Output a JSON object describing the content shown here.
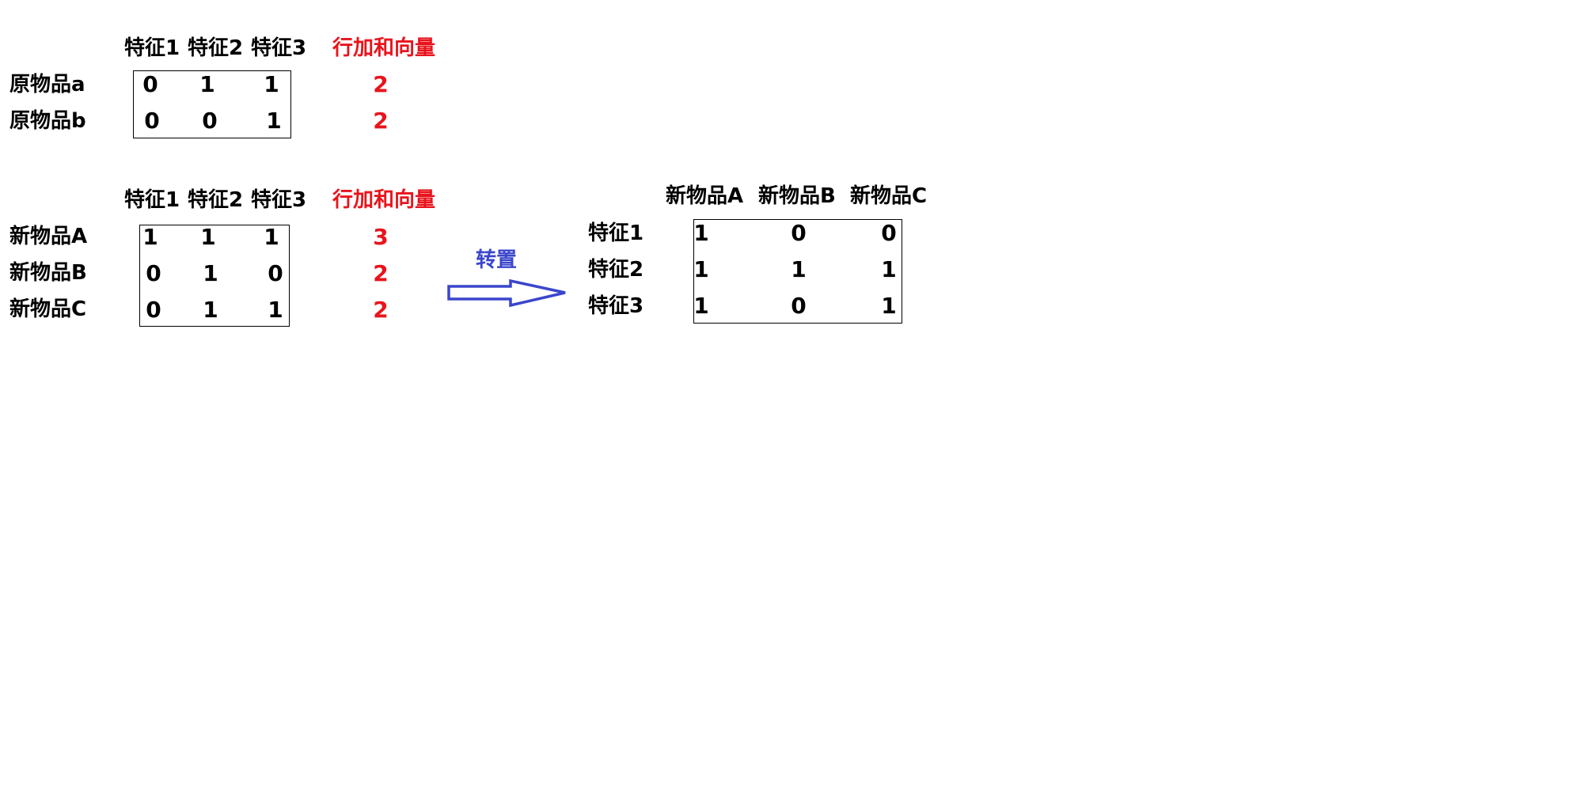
{
  "colors": {
    "text": "#000000",
    "highlight": "#e8141c",
    "arrow": "#3a46cc",
    "background": "#ffffff"
  },
  "original": {
    "headers": [
      "特征1",
      "特征2",
      "特征3"
    ],
    "sum_header": "行加和向量",
    "rows": [
      {
        "label": "原物品a",
        "values": [
          "0",
          "1",
          "1"
        ],
        "sum": "2"
      },
      {
        "label": "原物品b",
        "values": [
          "0",
          "0",
          "1"
        ],
        "sum": "2"
      }
    ]
  },
  "new": {
    "headers": [
      "特征1",
      "特征2",
      "特征3"
    ],
    "sum_header": "行加和向量",
    "rows": [
      {
        "label": "新物品A",
        "values": [
          "1",
          "1",
          "1"
        ],
        "sum": "3"
      },
      {
        "label": "新物品B",
        "values": [
          "0",
          "1",
          "0"
        ],
        "sum": "2"
      },
      {
        "label": "新物品C",
        "values": [
          "0",
          "1",
          "1"
        ],
        "sum": "2"
      }
    ]
  },
  "transpose_arrow": {
    "label": "转置",
    "icon": "right-arrow-icon"
  },
  "transposed": {
    "headers": [
      "新物品A",
      "新物品B",
      "新物品C"
    ],
    "rows": [
      {
        "label": "特征1",
        "values": [
          "1",
          "0",
          "0"
        ]
      },
      {
        "label": "特征2",
        "values": [
          "1",
          "1",
          "1"
        ]
      },
      {
        "label": "特征3",
        "values": [
          "1",
          "0",
          "1"
        ]
      }
    ]
  }
}
